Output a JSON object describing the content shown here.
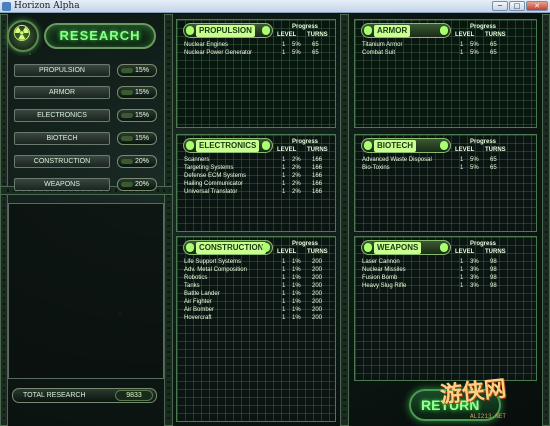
{
  "window": {
    "title": "Horizon Alpha",
    "min": "─",
    "max": "□",
    "close": "✕"
  },
  "research": {
    "heading": "RESEARCH"
  },
  "categories": [
    {
      "label": "PROPULSION",
      "value": "15%"
    },
    {
      "label": "ARMOR",
      "value": "15%"
    },
    {
      "label": "ELECTRONICS",
      "value": "15%"
    },
    {
      "label": "BIOTECH",
      "value": "15%"
    },
    {
      "label": "CONSTRUCTION",
      "value": "20%"
    },
    {
      "label": "WEAPONS",
      "value": "20%"
    }
  ],
  "total": {
    "label": "TOTAL RESEARCH",
    "value": "9833"
  },
  "columns": {
    "progress": "Progress",
    "level": "LEVEL",
    "turns": "TURNS"
  },
  "panels": {
    "propulsion": {
      "title": "PROPULSION",
      "rows": [
        {
          "name": "Nuclear Engines",
          "level": "1",
          "pct": "5%",
          "turns": "65"
        },
        {
          "name": "Nuclear Power Generator",
          "level": "1",
          "pct": "5%",
          "turns": "65"
        }
      ]
    },
    "armor": {
      "title": "ARMOR",
      "rows": [
        {
          "name": "Titanium Armor",
          "level": "1",
          "pct": "5%",
          "turns": "65"
        },
        {
          "name": "Combat Suit",
          "level": "1",
          "pct": "5%",
          "turns": "65"
        }
      ]
    },
    "electronics": {
      "title": "ELECTRONICS",
      "rows": [
        {
          "name": "Scanners",
          "level": "1",
          "pct": "2%",
          "turns": "166"
        },
        {
          "name": "Targeting Systems",
          "level": "1",
          "pct": "2%",
          "turns": "166"
        },
        {
          "name": "Defense ECM Systems",
          "level": "1",
          "pct": "2%",
          "turns": "166"
        },
        {
          "name": "Hailing Communicator",
          "level": "1",
          "pct": "2%",
          "turns": "166"
        },
        {
          "name": "Universal Translator",
          "level": "1",
          "pct": "2%",
          "turns": "166"
        }
      ]
    },
    "biotech": {
      "title": "BIOTECH",
      "rows": [
        {
          "name": "Advanced Waste Disposal",
          "level": "1",
          "pct": "5%",
          "turns": "65"
        },
        {
          "name": "Bio-Toxins",
          "level": "1",
          "pct": "5%",
          "turns": "65"
        }
      ]
    },
    "construction": {
      "title": "CONSTRUCTION",
      "rows": [
        {
          "name": "Life Support Systems",
          "level": "1",
          "pct": "1%",
          "turns": "200"
        },
        {
          "name": "Adv. Metal Composition",
          "level": "1",
          "pct": "1%",
          "turns": "200"
        },
        {
          "name": "Robotics",
          "level": "1",
          "pct": "1%",
          "turns": "200"
        },
        {
          "name": "Tanks",
          "level": "1",
          "pct": "1%",
          "turns": "200"
        },
        {
          "name": "Battle Lander",
          "level": "1",
          "pct": "1%",
          "turns": "200"
        },
        {
          "name": "Air Fighter",
          "level": "1",
          "pct": "1%",
          "turns": "200"
        },
        {
          "name": "Air Bomber",
          "level": "1",
          "pct": "1%",
          "turns": "200"
        },
        {
          "name": "Hovercraft",
          "level": "1",
          "pct": "1%",
          "turns": "200"
        }
      ]
    },
    "weapons": {
      "title": "WEAPONS",
      "rows": [
        {
          "name": "Laser Cannon",
          "level": "1",
          "pct": "3%",
          "turns": "98"
        },
        {
          "name": "Nuclear Missiles",
          "level": "1",
          "pct": "3%",
          "turns": "98"
        },
        {
          "name": "Fusion Bomb",
          "level": "1",
          "pct": "3%",
          "turns": "98"
        },
        {
          "name": "Heavy Slug Rifle",
          "level": "1",
          "pct": "3%",
          "turns": "98"
        }
      ]
    }
  },
  "return_button": {
    "label": "RETURN"
  },
  "watermark": {
    "text": "游侠网",
    "url": "ALI213.NET"
  }
}
